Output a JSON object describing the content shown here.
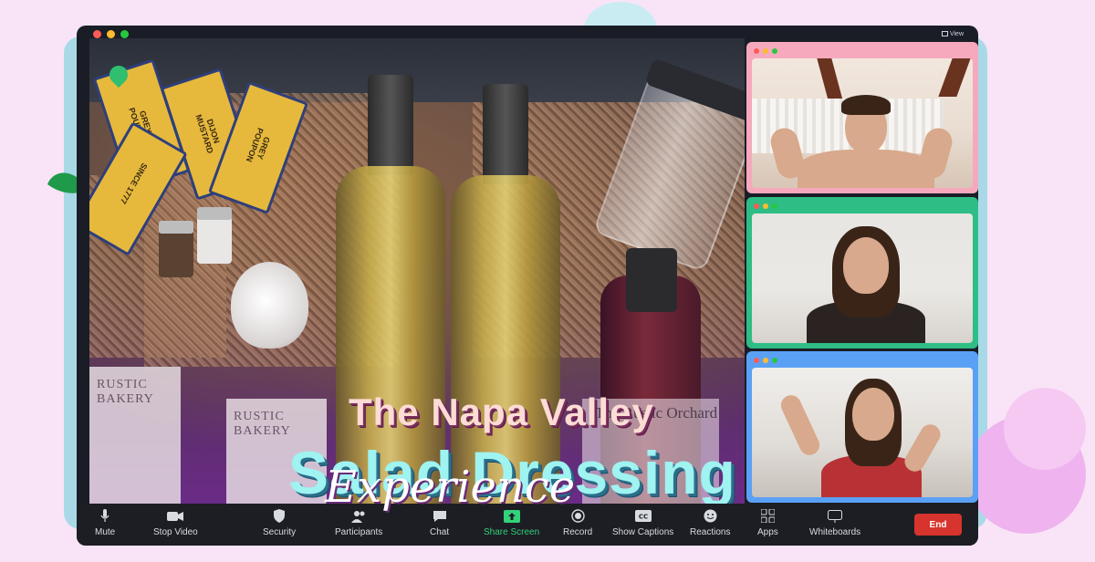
{
  "window": {
    "view_label": "View"
  },
  "stage": {
    "packet_lines": [
      "GREY POUPON",
      "DIJON MUSTARD"
    ],
    "packet_since": "SINCE 1777",
    "label_rustic_bakery": "RUSTIC BAKERY",
    "label_rustic_orchard": "The Rustic Orchard",
    "title_line1": "The Napa Valley",
    "title_line2": "Salad Dressing",
    "title_line3": "Experience"
  },
  "toolbar": {
    "items": [
      {
        "label": "Mute",
        "icon": "microphone-icon"
      },
      {
        "label": "Stop Video",
        "icon": "video-camera-icon"
      },
      {
        "label": "Security",
        "icon": "shield-icon"
      },
      {
        "label": "Participants",
        "icon": "participants-icon"
      },
      {
        "label": "Chat",
        "icon": "chat-bubble-icon"
      },
      {
        "label": "Share Screen",
        "icon": "share-screen-icon"
      },
      {
        "label": "Record",
        "icon": "record-icon"
      },
      {
        "label": "Show Captions",
        "icon": "captions-icon"
      },
      {
        "label": "Reactions",
        "icon": "emoji-icon"
      },
      {
        "label": "Apps",
        "icon": "apps-icon"
      },
      {
        "label": "Whiteboards",
        "icon": "whiteboard-icon"
      }
    ],
    "end_label": "End"
  },
  "colors": {
    "background": "#f9e4f7",
    "tile_1": "#f6a9bd",
    "tile_2": "#2ebd84",
    "tile_3": "#5aa1f5",
    "share_green": "#33d17a",
    "end_red": "#d6342c"
  }
}
